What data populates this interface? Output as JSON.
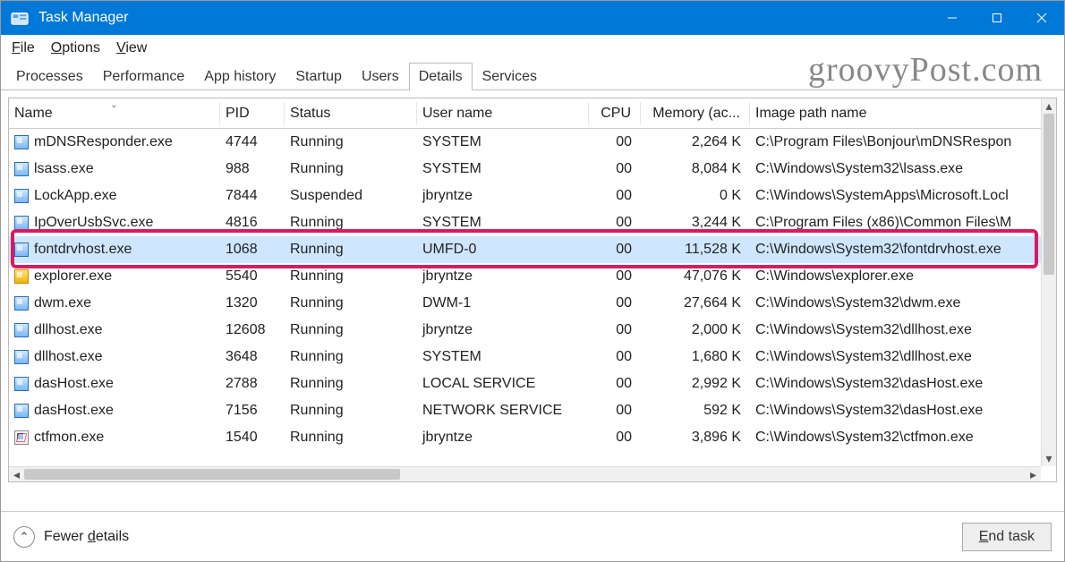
{
  "window": {
    "title": "Task Manager",
    "watermark": "groovyPost.com"
  },
  "menu": {
    "file": "File",
    "options": "Options",
    "view": "View"
  },
  "tabs": {
    "items": [
      "Processes",
      "Performance",
      "App history",
      "Startup",
      "Users",
      "Details",
      "Services"
    ],
    "activeIndex": 5
  },
  "columns": {
    "name": "Name",
    "pid": "PID",
    "status": "Status",
    "user": "User name",
    "cpu": "CPU",
    "memory": "Memory (ac...",
    "path": "Image path name"
  },
  "rows": [
    {
      "icon": "proc",
      "name": "mDNSResponder.exe",
      "pid": "4744",
      "status": "Running",
      "user": "SYSTEM",
      "cpu": "00",
      "mem": "2,264 K",
      "path": "C:\\Program Files\\Bonjour\\mDNSRespon"
    },
    {
      "icon": "proc",
      "name": "lsass.exe",
      "pid": "988",
      "status": "Running",
      "user": "SYSTEM",
      "cpu": "00",
      "mem": "8,084 K",
      "path": "C:\\Windows\\System32\\lsass.exe"
    },
    {
      "icon": "proc",
      "name": "LockApp.exe",
      "pid": "7844",
      "status": "Suspended",
      "user": "jbryntze",
      "cpu": "00",
      "mem": "0 K",
      "path": "C:\\Windows\\SystemApps\\Microsoft.Locl"
    },
    {
      "icon": "proc",
      "name": "IpOverUsbSvc.exe",
      "pid": "4816",
      "status": "Running",
      "user": "SYSTEM",
      "cpu": "00",
      "mem": "3,244 K",
      "path": "C:\\Program Files (x86)\\Common Files\\M"
    },
    {
      "icon": "proc",
      "name": "fontdrvhost.exe",
      "pid": "1068",
      "status": "Running",
      "user": "UMFD-0",
      "cpu": "00",
      "mem": "11,528 K",
      "path": "C:\\Windows\\System32\\fontdrvhost.exe",
      "selected": true,
      "highlighted": true
    },
    {
      "icon": "explorer",
      "name": "explorer.exe",
      "pid": "5540",
      "status": "Running",
      "user": "jbryntze",
      "cpu": "00",
      "mem": "47,076 K",
      "path": "C:\\Windows\\explorer.exe"
    },
    {
      "icon": "proc",
      "name": "dwm.exe",
      "pid": "1320",
      "status": "Running",
      "user": "DWM-1",
      "cpu": "00",
      "mem": "27,664 K",
      "path": "C:\\Windows\\System32\\dwm.exe"
    },
    {
      "icon": "proc",
      "name": "dllhost.exe",
      "pid": "12608",
      "status": "Running",
      "user": "jbryntze",
      "cpu": "00",
      "mem": "2,000 K",
      "path": "C:\\Windows\\System32\\dllhost.exe"
    },
    {
      "icon": "proc",
      "name": "dllhost.exe",
      "pid": "3648",
      "status": "Running",
      "user": "SYSTEM",
      "cpu": "00",
      "mem": "1,680 K",
      "path": "C:\\Windows\\System32\\dllhost.exe"
    },
    {
      "icon": "proc",
      "name": "dasHost.exe",
      "pid": "2788",
      "status": "Running",
      "user": "LOCAL SERVICE",
      "cpu": "00",
      "mem": "2,992 K",
      "path": "C:\\Windows\\System32\\dasHost.exe"
    },
    {
      "icon": "proc",
      "name": "dasHost.exe",
      "pid": "7156",
      "status": "Running",
      "user": "NETWORK SERVICE",
      "cpu": "00",
      "mem": "592 K",
      "path": "C:\\Windows\\System32\\dasHost.exe"
    },
    {
      "icon": "ctfmon",
      "name": "ctfmon.exe",
      "pid": "1540",
      "status": "Running",
      "user": "jbryntze",
      "cpu": "00",
      "mem": "3,896 K",
      "path": "C:\\Windows\\System32\\ctfmon.exe"
    }
  ],
  "footer": {
    "fewer": "Fewer details",
    "endtask": "End task"
  }
}
